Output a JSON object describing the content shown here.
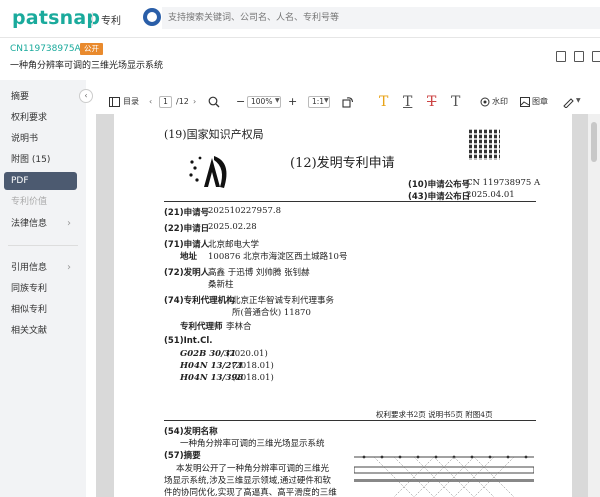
{
  "header": {
    "logo": "patsnap",
    "module": "专利",
    "search_placeholder": "支持搜索关键词、公司名、人名、专利号等"
  },
  "patent": {
    "id": "CN119738975A",
    "status": "公开",
    "title": "一种角分辨率可调的三维光场显示系统"
  },
  "sidebar": {
    "items": [
      {
        "label": "摘要"
      },
      {
        "label": "权利要求"
      },
      {
        "label": "说明书"
      },
      {
        "label": "附图 (15)"
      },
      {
        "label": "PDF"
      },
      {
        "label": "专利价值"
      },
      {
        "label": "法律信息"
      },
      {
        "label": "引用信息"
      },
      {
        "label": "同族专利"
      },
      {
        "label": "相似专利"
      },
      {
        "label": "相关文献"
      }
    ]
  },
  "toolbar": {
    "toc": "目录",
    "page_current": "1",
    "page_total": "/12",
    "zoom": "100%",
    "ratio": "1:1",
    "watermark": "水印",
    "figure": "图章"
  },
  "doc": {
    "office": "(19)国家知识产权局",
    "doc_type": "(12)发明专利申请",
    "pub_no_label": "(10)申请公布号",
    "pub_no": "CN 119738975 A",
    "pub_date_label": "(43)申请公布日",
    "pub_date": "2025.04.01",
    "app_no_label": "(21)申请号",
    "app_no": "202510227957.8",
    "app_date_label": "(22)申请日",
    "app_date": "2025.02.28",
    "applicant_label": "(71)申请人",
    "applicant": "北京邮电大学",
    "address_label": "地址",
    "address": "100876 北京市海淀区西土城路10号",
    "inventor_label": "(72)发明人",
    "inventors_1": "高鑫  于迅博  刘帅腾  张钊赫",
    "inventors_2": "桑新柱",
    "agency_label": "(74)专利代理机构",
    "agency_1": "北京正华智诚专利代理事务",
    "agency_2": "所(普通合伙) 11870",
    "agent_label": "专利代理师",
    "agent": "李林合",
    "intcl_label": "(51)Int.Cl.",
    "ipc_1": "G02B 30/31",
    "ipc_1d": "(2020.01)",
    "ipc_2": "H04N 13/271",
    "ipc_2d": "(2018.01)",
    "ipc_3": "H04N 13/398",
    "ipc_3d": "(2018.01)",
    "footer_note": "权利要求书2页  说明书5页  附图4页",
    "name_label": "(54)发明名称",
    "name": "一种角分辨率可调的三维光场显示系统",
    "abstract_label": "(57)摘要",
    "abstract_1": "本发明公开了一种角分辨率可调的三维光",
    "abstract_2": "场显示系统,涉及三维显示领域,通过硬件和软",
    "abstract_3": "件的协同优化,实现了高逼真、高平滑度的三维"
  },
  "icons": [
    "search-icon",
    "toc-icon",
    "zoom-search-icon",
    "zoom-out-icon",
    "zoom-in-icon",
    "rotate-icon",
    "text-highlight-icon",
    "text-underline-icon",
    "text-strike-icon",
    "text-plain-icon",
    "watermark-icon",
    "stamp-icon",
    "pen-icon",
    "download-icon",
    "favorite-icon",
    "export-icon"
  ],
  "colors": {
    "brand": "#1aaa9c",
    "badge": "#e98a2d",
    "active_nav": "#4c5a70",
    "highlight_tool": "#e8a317"
  }
}
